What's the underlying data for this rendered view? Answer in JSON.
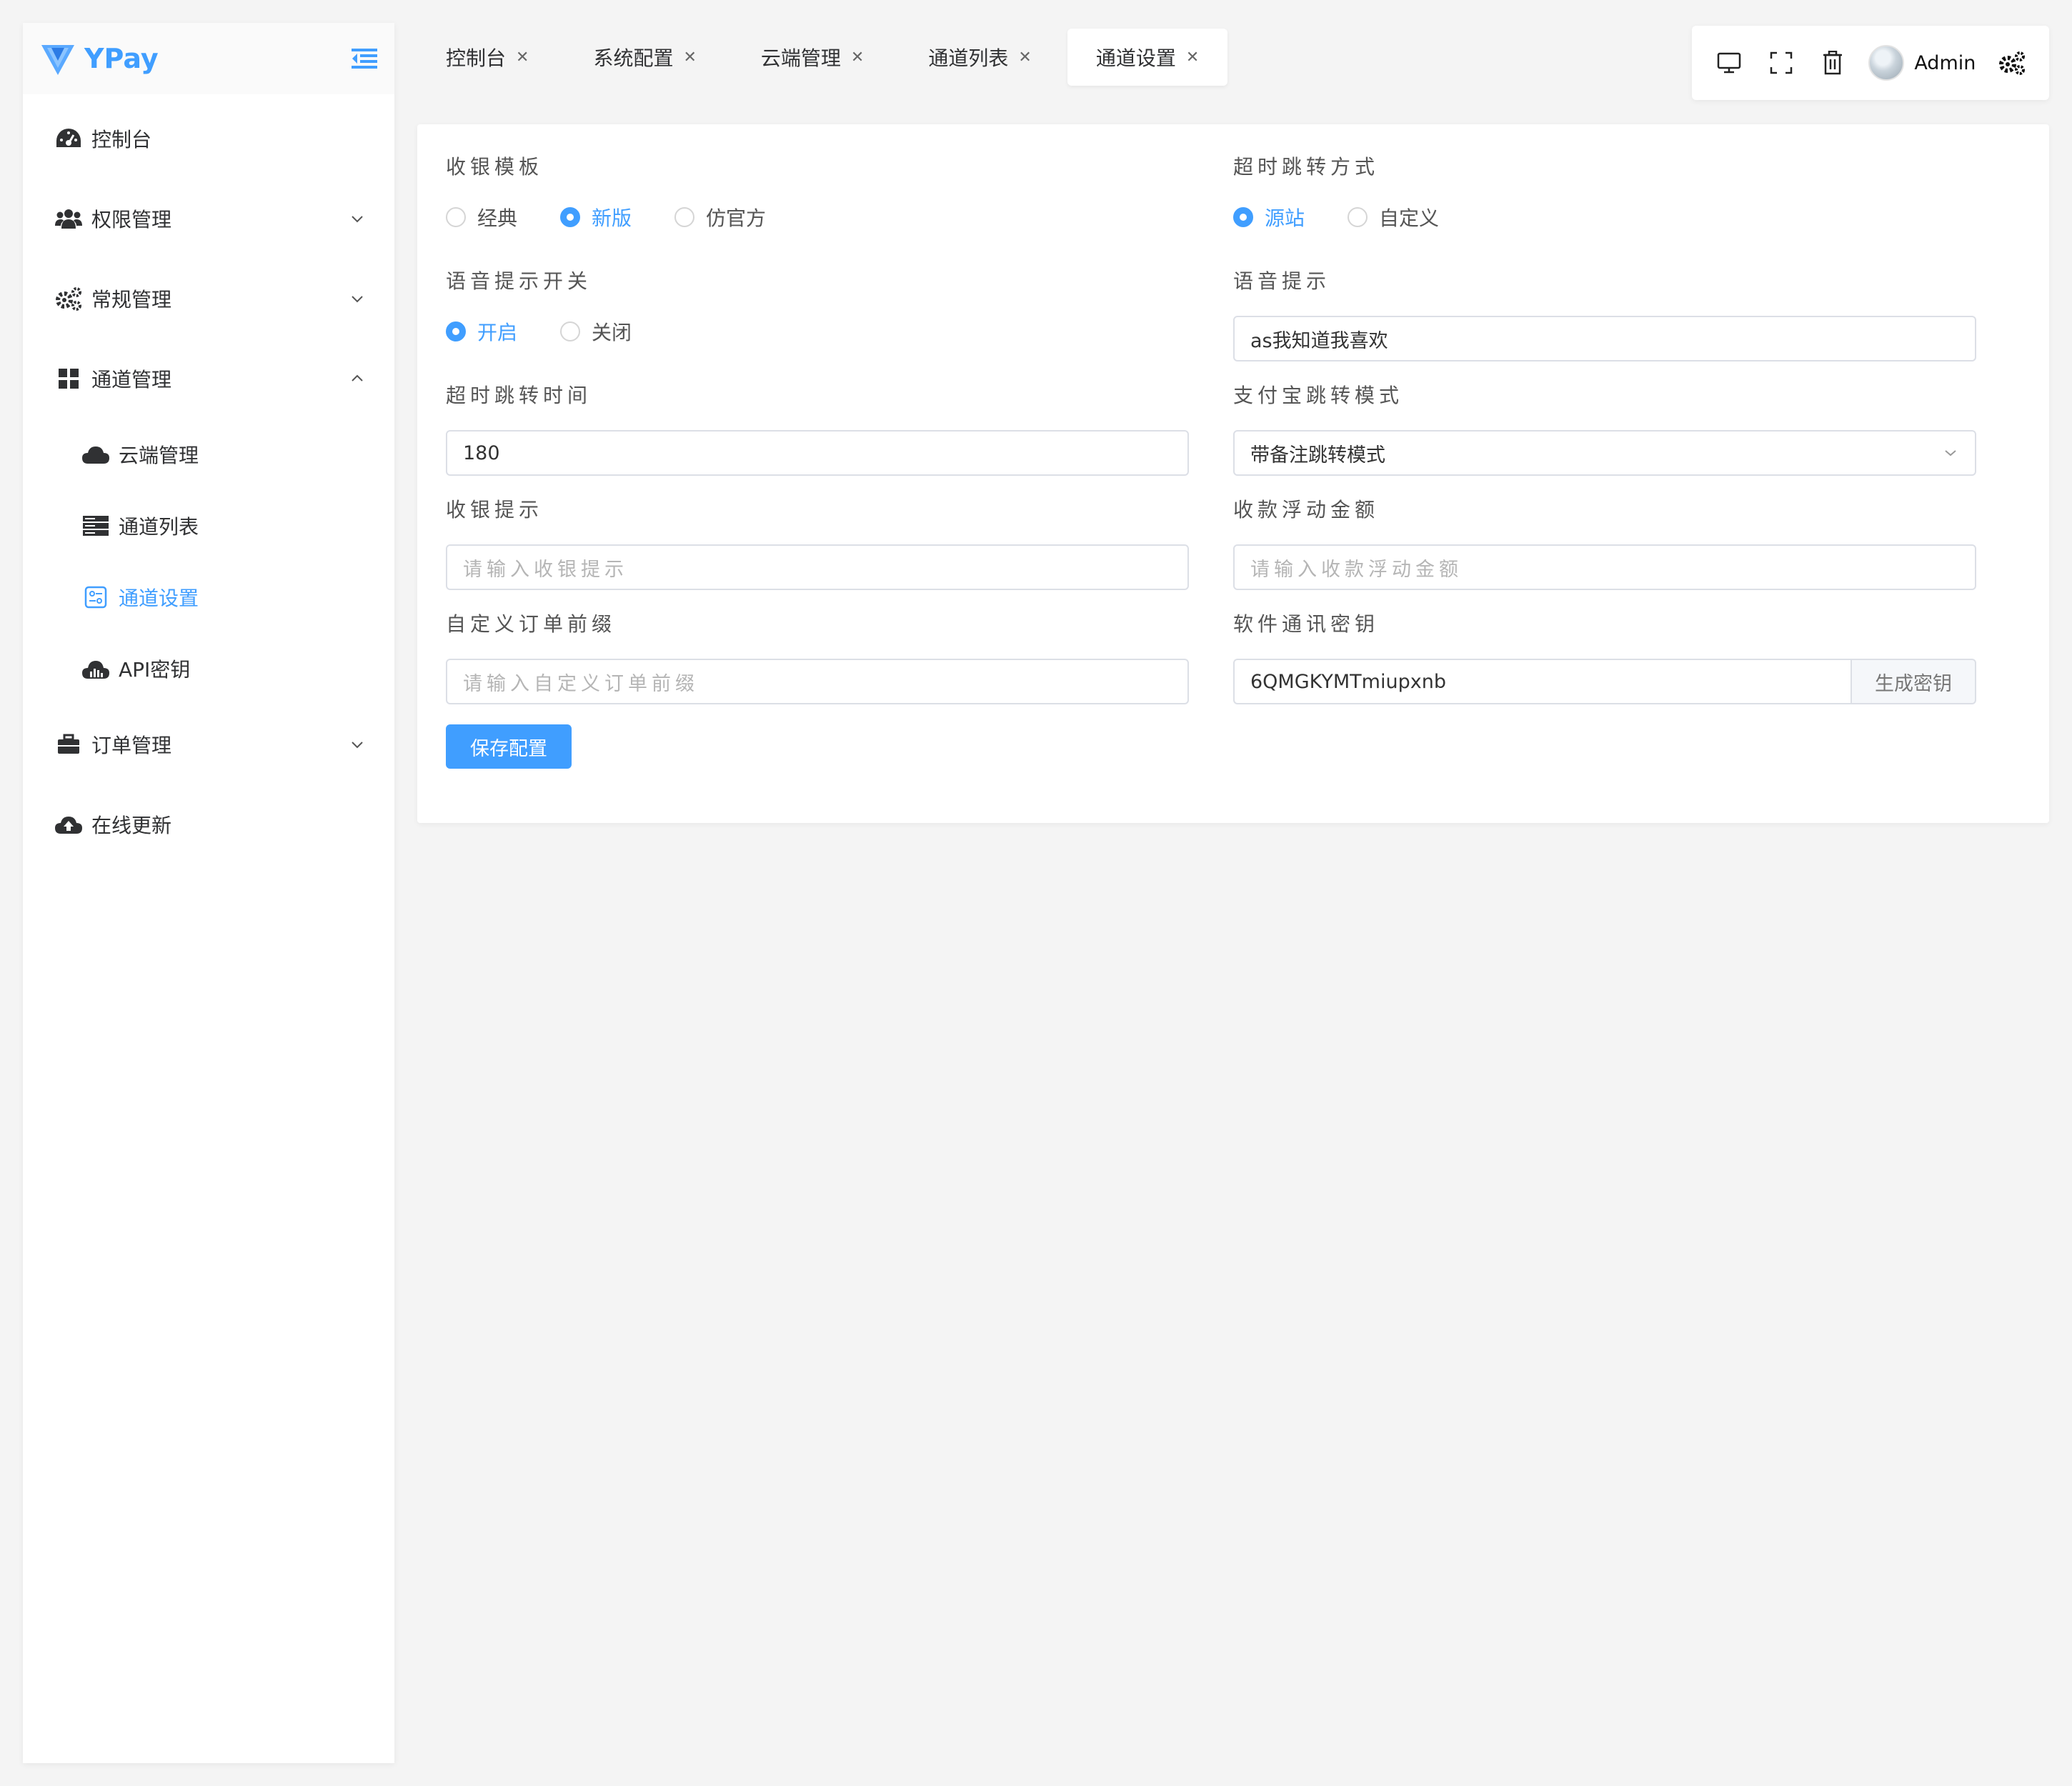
{
  "app": {
    "name": "YPay"
  },
  "sidebar": {
    "items": [
      {
        "label": "控制台",
        "icon": "dashboard-icon"
      },
      {
        "label": "权限管理",
        "icon": "users-icon",
        "expanded": false
      },
      {
        "label": "常规管理",
        "icon": "gears-icon",
        "expanded": false
      },
      {
        "label": "通道管理",
        "icon": "grid-icon",
        "expanded": true
      },
      {
        "label": "订单管理",
        "icon": "briefcase-icon",
        "expanded": false
      },
      {
        "label": "在线更新",
        "icon": "cloud-upload-icon"
      }
    ],
    "channel_sub": [
      {
        "label": "云端管理",
        "icon": "cloud-icon"
      },
      {
        "label": "通道列表",
        "icon": "server-icon"
      },
      {
        "label": "通道设置",
        "icon": "settings-panel-icon",
        "active": true
      },
      {
        "label": "API密钥",
        "icon": "chart-cloud-icon"
      }
    ]
  },
  "tabs": [
    {
      "label": "控制台"
    },
    {
      "label": "系统配置"
    },
    {
      "label": "云端管理"
    },
    {
      "label": "通道列表"
    },
    {
      "label": "通道设置",
      "active": true
    }
  ],
  "toolbar": {
    "user": "Admin"
  },
  "form": {
    "cashier_template": {
      "label": "收银模板",
      "options": [
        "经典",
        "新版",
        "仿官方"
      ],
      "selected": "新版"
    },
    "timeout_redirect_mode": {
      "label": "超时跳转方式",
      "options": [
        "源站",
        "自定义"
      ],
      "selected": "源站"
    },
    "voice_switch": {
      "label": "语音提示开关",
      "options": [
        "开启",
        "关闭"
      ],
      "selected": "开启"
    },
    "voice_prompt": {
      "label": "语音提示",
      "value": "as我知道我喜欢"
    },
    "timeout_time": {
      "label": "超时跳转时间",
      "value": "180"
    },
    "alipay_mode": {
      "label": "支付宝跳转模式",
      "value": "带备注跳转模式"
    },
    "cashier_tip": {
      "label": "收银提示",
      "placeholder": "请输入收银提示"
    },
    "float_amount": {
      "label": "收款浮动金额",
      "placeholder": "请输入收款浮动金额"
    },
    "order_prefix": {
      "label": "自定义订单前缀",
      "placeholder": "请输入自定义订单前缀"
    },
    "software_key": {
      "label": "软件通讯密钥",
      "value": "6QMGKYMTmiupxnb",
      "button": "生成密钥"
    },
    "save_button": "保存配置"
  },
  "colors": {
    "accent": "#409eff",
    "background": "#f4f4f4"
  }
}
